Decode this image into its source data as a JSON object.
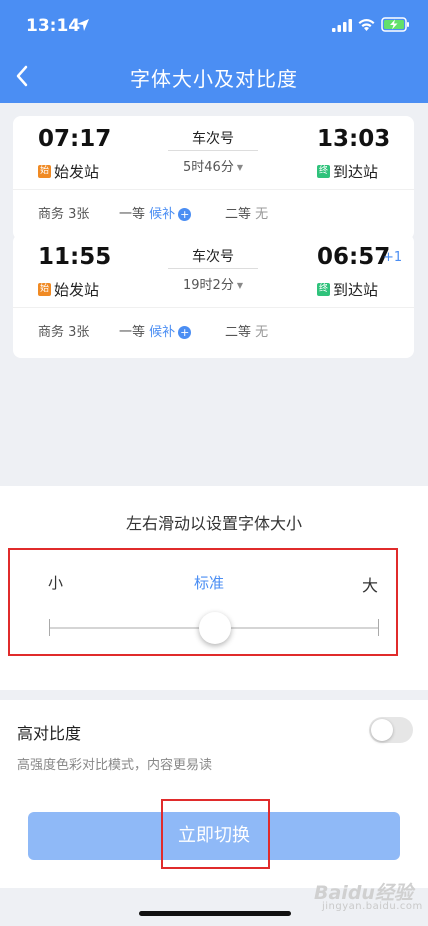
{
  "status_bar": {
    "time": "13:14"
  },
  "nav": {
    "title": "字体大小及对比度"
  },
  "trains": [
    {
      "depart_time": "07:17",
      "depart_station": "始发站",
      "depart_badge": "始",
      "train_no": "车次号",
      "duration": "5时46分",
      "arrive_time": "13:03",
      "arrive_station": "到达站",
      "arrive_badge": "终",
      "day_offset": "",
      "seats": {
        "business": {
          "label": "商务",
          "value": "3张"
        },
        "first": {
          "label": "一等",
          "value": "候补"
        },
        "second": {
          "label": "二等",
          "value": "无"
        }
      }
    },
    {
      "depart_time": "11:55",
      "depart_station": "始发站",
      "depart_badge": "始",
      "train_no": "车次号",
      "duration": "19时2分",
      "arrive_time": "06:57",
      "arrive_station": "到达站",
      "arrive_badge": "终",
      "day_offset": "+1",
      "seats": {
        "business": {
          "label": "商务",
          "value": "3张"
        },
        "first": {
          "label": "一等",
          "value": "候补"
        },
        "second": {
          "label": "二等",
          "value": "无"
        }
      }
    }
  ],
  "font_size": {
    "hint": "左右滑动以设置字体大小",
    "small_label": "小",
    "standard_label": "标准",
    "large_label": "大",
    "current_level": 0.5
  },
  "contrast": {
    "title": "高对比度",
    "description": "高强度色彩对比模式，内容更易读",
    "enabled": false
  },
  "switch_button": {
    "label": "立即切换"
  },
  "watermark": {
    "text": "Baidu经验",
    "sub": "jingyan.baidu.com"
  },
  "colors": {
    "primary": "#4b8ef3",
    "button_disabled": "#8fb9f7",
    "badge_start": "#f08a24",
    "badge_end": "#2fc27b",
    "annotation_red": "#e02b2b"
  }
}
